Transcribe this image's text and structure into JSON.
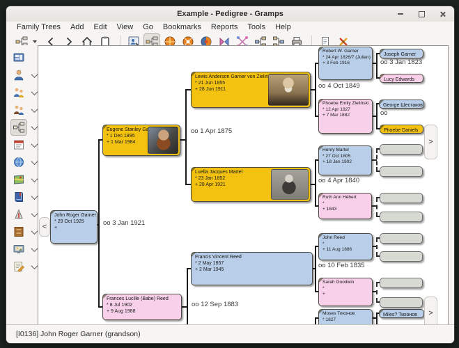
{
  "window": {
    "title": "Example - Pedigree - Gramps",
    "controls": [
      "minimize",
      "maximize",
      "close"
    ]
  },
  "menubar": {
    "items": [
      "Family Trees",
      "Add",
      "Edit",
      "View",
      "Go",
      "Bookmarks",
      "Reports",
      "Tools",
      "Help"
    ]
  },
  "toolbar": {
    "buttons": [
      "active-person-chart",
      "chart-dropdown-caret",
      "back",
      "forward",
      "home",
      "clipboard",
      "person-editor",
      "pedigree-view",
      "fan-chart-view",
      "fan-chart-descendant-view",
      "two-way-fan-view",
      "bowtie-chart",
      "descendant-chart",
      "tree-chart",
      "tree-chart-2",
      "print",
      "document",
      "configure"
    ]
  },
  "sidebar": {
    "categories": [
      "Dashboard",
      "People",
      "Relationships",
      "Families",
      "Charts",
      "Events",
      "Places",
      "Geography",
      "Sources",
      "Citations",
      "Repositories",
      "Media",
      "Notes"
    ],
    "active": "Charts"
  },
  "colors": {
    "accent_gold": "#f3c211",
    "male": "#b9cfe9",
    "female": "#f9d0e9",
    "unknown": "#d6dad2",
    "canvas": "#ffffff"
  },
  "pedigree": {
    "people": [
      {
        "name": "John Roger Garner",
        "birth": "* 29 Oct 1925",
        "death": "+",
        "color": "blue"
      },
      {
        "name": "Eugene Stanley Garner",
        "birth": "* 1 Dec 1895",
        "death": "+ 1 Mar 1984",
        "color": "gold"
      },
      {
        "name": "Frances Lucille (Babe) Reed",
        "birth": "* 8 Jul 1902",
        "death": "+ 9 Aug 1988",
        "color": "pink"
      },
      {
        "name": "Lewis Anderson Garner von Zieliński Sr",
        "birth": "* 21 Jun 1855",
        "death": "+ 28 Jun 1911",
        "color": "gold"
      },
      {
        "name": "Luella Jacques Martel",
        "birth": "* 23 Jan 1852",
        "death": "+ 28 Apr 1921",
        "color": "gold"
      },
      {
        "name": "Francis Vincent Reed",
        "birth": "* 2 May 1857",
        "death": "+ 2 Mar 1945",
        "color": "blue"
      },
      {
        "name": "Robert W. Garner",
        "birth": "* 24 Apr 1826/7 (Julian)",
        "death": "+ 3 Feb 1916",
        "color": "blue"
      },
      {
        "name": "Phoebe Emily Zieliński",
        "birth": "* 12 Apr 1827",
        "death": "+ 7 Mar 1882",
        "color": "pink"
      },
      {
        "name": "Henry Martel",
        "birth": "* 27 Oct 1805",
        "death": "+ 18 Jan 1902",
        "color": "blue"
      },
      {
        "name": "Ruth Ann Hébert",
        "birth": "*",
        "death": "+ 1843",
        "color": "pink"
      },
      {
        "name": "John Reed",
        "birth": "*",
        "death": "+ 11 Aug 1886",
        "color": "blue"
      },
      {
        "name": "Sarah Goodwin",
        "birth": "*",
        "death": "+",
        "color": "pink"
      },
      {
        "name": "Moses Тихонов",
        "birth": "* 1827",
        "death": "",
        "color": "blue"
      },
      {
        "name": "Joseph Garner",
        "color": "blue"
      },
      {
        "name": "Lucy Edwards",
        "color": "pink"
      },
      {
        "name": "George Шестаков",
        "color": "blue"
      },
      {
        "name": "Phoebe Daniels",
        "color": "gold"
      },
      {
        "name": "Miles? Тихонов",
        "color": "blue"
      }
    ],
    "marriages": [
      "oo 3 Jan 1921",
      "oo 1 Apr 1875",
      "oo 12 Sep 1883",
      "oo 4 Oct 1849",
      "oo 4 Apr 1840",
      "oo 10 Feb 1835",
      "oo 3 Jan 1823",
      "oo"
    ],
    "nav_left": "<",
    "nav_right": ">"
  },
  "statusbar": {
    "text": "[I0136] John Roger Garner (grandson)"
  }
}
